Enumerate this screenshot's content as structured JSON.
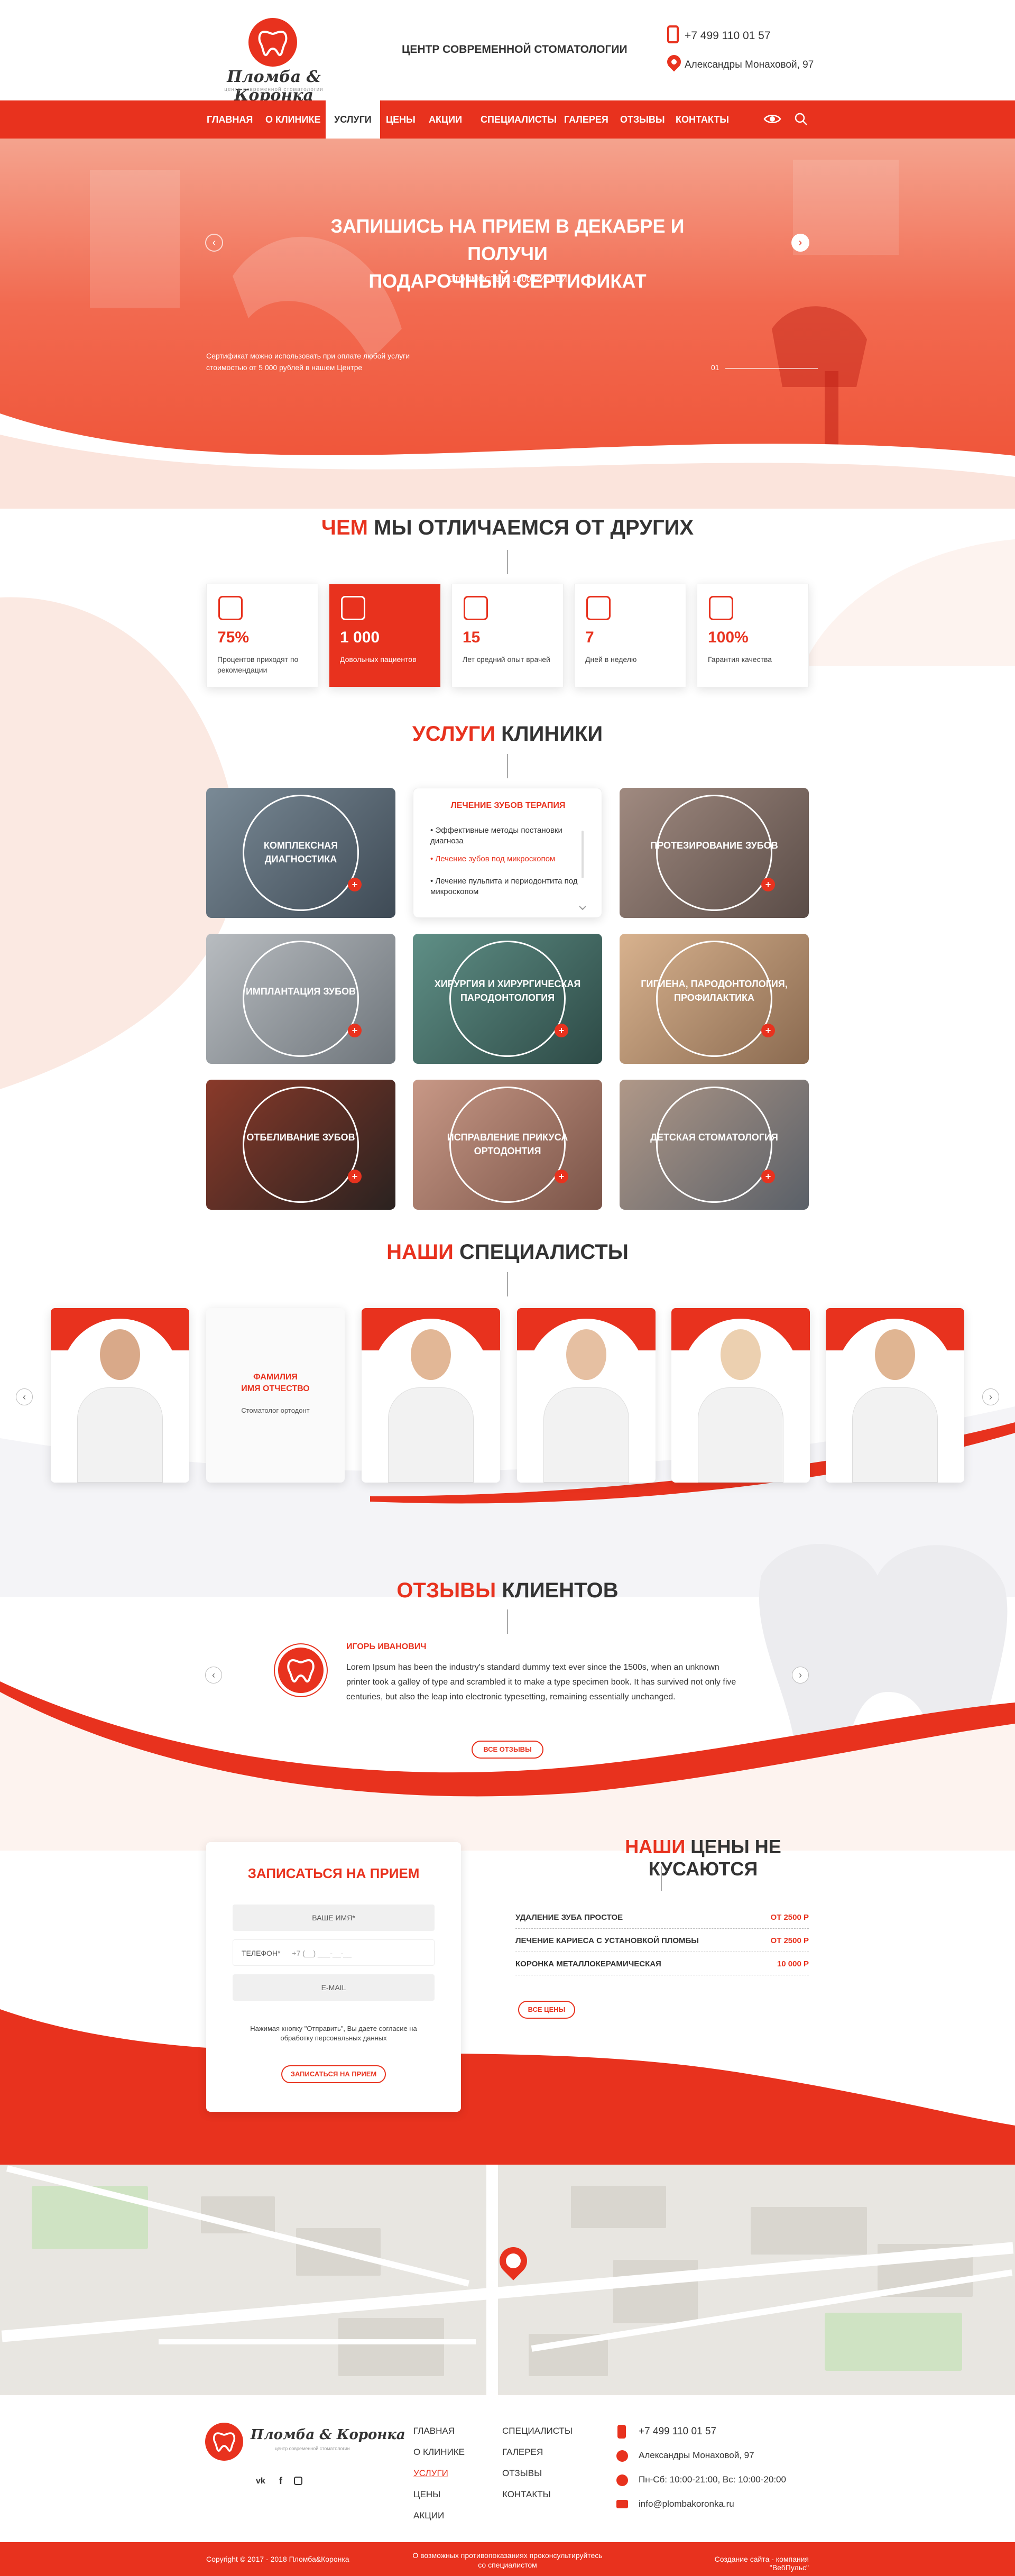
{
  "brand": {
    "name": "Пломба & Коронка",
    "tagline": "центр современной стоматологии",
    "accent": "#e8321e"
  },
  "header": {
    "center_title": "ЦЕНТР СОВРЕМЕННОЙ СТОМАТОЛОГИИ",
    "phone": "+7 499 110 01 57",
    "address": "Александры Монаховой, 97"
  },
  "nav": {
    "items": [
      "ГЛАВНАЯ",
      "О КЛИНИКЕ",
      "УСЛУГИ",
      "ЦЕНЫ",
      "АКЦИИ",
      "СПЕЦИАЛИСТЫ",
      "ГАЛЕРЕЯ",
      "ОТЗЫВЫ",
      "КОНТАКТЫ"
    ],
    "active": "УСЛУГИ",
    "icons": [
      "eye-icon",
      "search-icon"
    ]
  },
  "hero": {
    "title_line1": "ЗАПИШИСЬ НА ПРИЕМ В ДЕКАБРЕ И ПОЛУЧИ",
    "title_line2": "ПОДАРОЧНЫЙ СЕРТИФИКАТ",
    "subtitle": "СТОИМОСТЬЮ 1000 РУБЛЕЙ",
    "note_line1": "Сертификат можно использовать при оплате любой услуги",
    "note_line2": "стоимостью от 5 000 рублей в нашем Центре",
    "page": "01"
  },
  "diff": {
    "title_accent": "ЧЕМ",
    "title_rest": "МЫ ОТЛИЧАЕМСЯ ОТ ДРУГИХ",
    "stats": [
      {
        "value": "75%",
        "text": "Процентов приходят по рекомендации"
      },
      {
        "value": "1 000",
        "text": "Довольных пациентов"
      },
      {
        "value": "15",
        "text": "Лет средний опыт врачей"
      },
      {
        "value": "7",
        "text": "Дней в неделю"
      },
      {
        "value": "100%",
        "text": "Гарантия качества"
      }
    ]
  },
  "services": {
    "title_accent": "УСЛУГИ",
    "title_rest": "КЛИНИКИ",
    "cards": [
      "КОМПЛЕКСНАЯ ДИАГНОСТИКА",
      "ПРОТЕЗИРОВАНИЕ ЗУБОВ",
      "ИМПЛАНТАЦИЯ ЗУБОВ",
      "ХИРУРГИЯ И ХИРУРГИЧЕСКАЯ ПАРОДОНТОЛОГИЯ",
      "ГИГИЕНА, ПАРОДОНТОЛОГИЯ, ПРОФИЛАКТИКА",
      "ОТБЕЛИВАНИЕ ЗУБОВ",
      "ИСПРАВЛЕНИЕ ПРИКУСА ОРТОДОНТИЯ",
      "ДЕТСКАЯ СТОМАТОЛОГИЯ"
    ],
    "open_card": {
      "title": "ЛЕЧЕНИЕ ЗУБОВ ТЕРАПИЯ",
      "items": [
        "Эффективные методы постановки диагноза",
        "Лечение зубов под микроскопом",
        "Лечение пульпита и периодонтита под микроскопом"
      ]
    }
  },
  "specialists": {
    "title_accent": "НАШИ",
    "title_rest": "СПЕЦИАЛИСТЫ",
    "hover_name_1": "ФАМИЛИЯ",
    "hover_name_2": "ИМЯ ОТЧЕСТВО",
    "hover_role": "Стоматолог ортодонт"
  },
  "reviews": {
    "title_accent": "ОТЗЫВЫ",
    "title_rest": "КЛИЕНТОВ",
    "name": "ИГОРЬ ИВАНОВИЧ",
    "text": "Lorem Ipsum has been the industry's standard dummy text ever since the 1500s, when an unknown printer took a galley of type and scrambled it to make a type specimen book. It has survived not only five centuries, but also the leap into electronic typesetting, remaining essentially unchanged.",
    "all_button": "ВСЕ ОТЗЫВЫ"
  },
  "form": {
    "title": "ЗАПИСАТЬСЯ НА ПРИЕМ",
    "name_placeholder": "ВАШЕ ИМЯ*",
    "phone_label": "ТЕЛЕФОН*",
    "phone_mask": "+7 (__) ___-__-__",
    "email_placeholder": "E-MAIL",
    "note": "Нажимая кнопку \"Отправить\", Вы даете согласие на обработку персональных данных",
    "submit": "ЗАПИСАТЬСЯ НА ПРИЕМ"
  },
  "prices": {
    "title_accent": "НАШИ",
    "title_rest": "ЦЕНЫ НЕ КУСАЮТСЯ",
    "rows": [
      {
        "name": "УДАЛЕНИЕ ЗУБА ПРОСТОЕ",
        "price": "ОТ 2500 Р"
      },
      {
        "name": "ЛЕЧЕНИЕ КАРИЕСА С УСТАНОВКОЙ ПЛОМБЫ",
        "price": "ОТ 2500 Р"
      },
      {
        "name": "КОРОНКА МЕТАЛЛОКЕРАМИЧЕСКАЯ",
        "price": "10 000 Р"
      }
    ],
    "all_button": "ВСЕ ЦЕНЫ"
  },
  "footer": {
    "links_col1": [
      "ГЛАВНАЯ",
      "О КЛИНИКЕ",
      "УСЛУГИ",
      "ЦЕНЫ",
      "АКЦИИ"
    ],
    "links_col2": [
      "СПЕЦИАЛИСТЫ",
      "ГАЛЕРЕЯ",
      "ОТЗЫВЫ",
      "КОНТАКТЫ"
    ],
    "active": "УСЛУГИ",
    "phone": "+7 499 110 01 57",
    "address": "Александры Монаховой, 97",
    "hours": "Пн-Сб: 10:00-21:00, Вс: 10:00-20:00",
    "email": "info@plombakoronka.ru",
    "copyright": "Copyright © 2017 - 2018 Пломба&Коронка",
    "disclaimer_1": "О возможных противопоказаниях проконсультируйтесь",
    "disclaimer_2": "со специалистом",
    "made_by": "Создание сайта - компания \"ВебПульс\"",
    "social_icons": [
      "vk-icon",
      "facebook-icon",
      "instagram-icon"
    ]
  }
}
